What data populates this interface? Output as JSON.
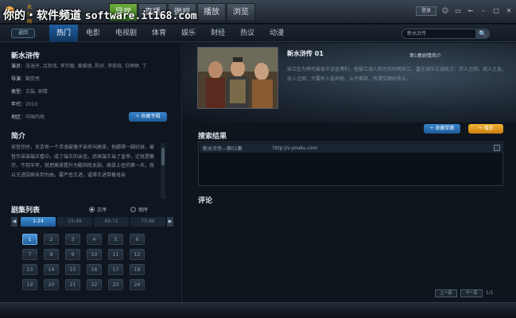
{
  "watermark": {
    "cn": "你的・软件频道",
    "url": "software.it168.com"
  },
  "brand": "风行网络",
  "main_tabs": [
    "导视",
    "直播",
    "微视",
    "播放",
    "浏览"
  ],
  "login_label": "登录",
  "categories": [
    "热门",
    "电影",
    "电视剧",
    "体育",
    "娱乐",
    "财经",
    "热议",
    "动漫"
  ],
  "back_label": "返回",
  "search": {
    "placeholder": "新水浒传",
    "btn": "🔍"
  },
  "show": {
    "title": "新水浒传",
    "cast_key": "演员",
    "cast": "张涵予, 吕良伟, 李宗翰, 黄维德, 陈好, 李依晓, 甘婷婷, 丁",
    "director_key": "导演",
    "director": "鞠觉亮",
    "type_key": "类型",
    "type": "古装, 剧情",
    "year_key": "年代",
    "year": "2010",
    "region_key": "地区",
    "region": "中国内地",
    "fav_label": "+ 收藏专辑"
  },
  "synopsis": {
    "title": "简介",
    "text": "宋哲宗时，东京有一个浮浪破落子弟名叫高俅，他踢得一脚好球，被哲宗弟弟端王看中，成了端王的亲信。后来端王当了皇帝，迁就是徽宗，不到半年，就把高俅提升为殿帅府太尉。高俅上任的第一天，就以王进因病未到为由，要严惩王进，逼得王进带着母亲"
  },
  "episodes": {
    "title": "剧集列表",
    "order_asc": "正序",
    "order_desc": "倒序",
    "ranges": [
      "1-24",
      "25-48",
      "49-72",
      "73-96"
    ],
    "list": [
      "1",
      "2",
      "3",
      "4",
      "5",
      "6",
      "7",
      "8",
      "9",
      "10",
      "11",
      "12",
      "13",
      "14",
      "15",
      "16",
      "17",
      "18",
      "19",
      "20",
      "21",
      "22",
      "23",
      "24"
    ]
  },
  "detail": {
    "ep_title": "新水浒传 01",
    "ep_subtitle": "第1集剧情简介",
    "desc": "宋江在为押司曾县令送送博利，他被江湖人称为及时雨宋江，嘉在城中江湖各方：济人之困，周人之急，扶人之困，只要有人投奔他，从不推辞，所谓交朝好侠义。",
    "fav_btn": "+ 收藏单集",
    "play_btn": "+ 播放"
  },
  "results": {
    "title": "搜索结果",
    "rows": [
      {
        "title": "新水浒传—第01集",
        "url": "http://v.youku.com"
      }
    ]
  },
  "comments": {
    "title": "评论"
  },
  "pager": {
    "prev": "上一页",
    "next": "下一页",
    "page": "1/1"
  },
  "colors": {
    "accent_blue": "#2a72b8",
    "accent_green": "#4f8f2a",
    "accent_orange": "#e39a22"
  }
}
